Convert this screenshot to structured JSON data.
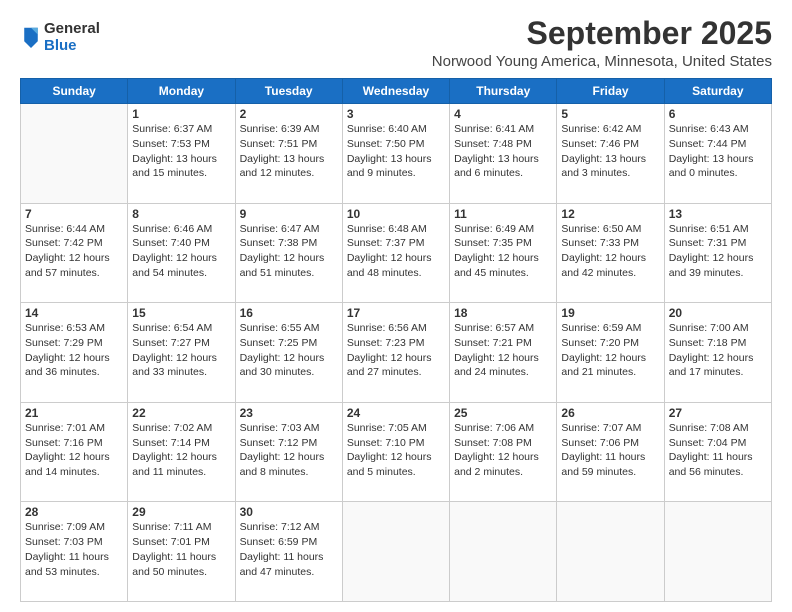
{
  "header": {
    "logo_line1": "General",
    "logo_line2": "Blue",
    "title": "September 2025",
    "subtitle": "Norwood Young America, Minnesota, United States"
  },
  "days_of_week": [
    "Sunday",
    "Monday",
    "Tuesday",
    "Wednesday",
    "Thursday",
    "Friday",
    "Saturday"
  ],
  "weeks": [
    [
      {
        "day": "",
        "info": ""
      },
      {
        "day": "1",
        "info": "Sunrise: 6:37 AM\nSunset: 7:53 PM\nDaylight: 13 hours\nand 15 minutes."
      },
      {
        "day": "2",
        "info": "Sunrise: 6:39 AM\nSunset: 7:51 PM\nDaylight: 13 hours\nand 12 minutes."
      },
      {
        "day": "3",
        "info": "Sunrise: 6:40 AM\nSunset: 7:50 PM\nDaylight: 13 hours\nand 9 minutes."
      },
      {
        "day": "4",
        "info": "Sunrise: 6:41 AM\nSunset: 7:48 PM\nDaylight: 13 hours\nand 6 minutes."
      },
      {
        "day": "5",
        "info": "Sunrise: 6:42 AM\nSunset: 7:46 PM\nDaylight: 13 hours\nand 3 minutes."
      },
      {
        "day": "6",
        "info": "Sunrise: 6:43 AM\nSunset: 7:44 PM\nDaylight: 13 hours\nand 0 minutes."
      }
    ],
    [
      {
        "day": "7",
        "info": "Sunrise: 6:44 AM\nSunset: 7:42 PM\nDaylight: 12 hours\nand 57 minutes."
      },
      {
        "day": "8",
        "info": "Sunrise: 6:46 AM\nSunset: 7:40 PM\nDaylight: 12 hours\nand 54 minutes."
      },
      {
        "day": "9",
        "info": "Sunrise: 6:47 AM\nSunset: 7:38 PM\nDaylight: 12 hours\nand 51 minutes."
      },
      {
        "day": "10",
        "info": "Sunrise: 6:48 AM\nSunset: 7:37 PM\nDaylight: 12 hours\nand 48 minutes."
      },
      {
        "day": "11",
        "info": "Sunrise: 6:49 AM\nSunset: 7:35 PM\nDaylight: 12 hours\nand 45 minutes."
      },
      {
        "day": "12",
        "info": "Sunrise: 6:50 AM\nSunset: 7:33 PM\nDaylight: 12 hours\nand 42 minutes."
      },
      {
        "day": "13",
        "info": "Sunrise: 6:51 AM\nSunset: 7:31 PM\nDaylight: 12 hours\nand 39 minutes."
      }
    ],
    [
      {
        "day": "14",
        "info": "Sunrise: 6:53 AM\nSunset: 7:29 PM\nDaylight: 12 hours\nand 36 minutes."
      },
      {
        "day": "15",
        "info": "Sunrise: 6:54 AM\nSunset: 7:27 PM\nDaylight: 12 hours\nand 33 minutes."
      },
      {
        "day": "16",
        "info": "Sunrise: 6:55 AM\nSunset: 7:25 PM\nDaylight: 12 hours\nand 30 minutes."
      },
      {
        "day": "17",
        "info": "Sunrise: 6:56 AM\nSunset: 7:23 PM\nDaylight: 12 hours\nand 27 minutes."
      },
      {
        "day": "18",
        "info": "Sunrise: 6:57 AM\nSunset: 7:21 PM\nDaylight: 12 hours\nand 24 minutes."
      },
      {
        "day": "19",
        "info": "Sunrise: 6:59 AM\nSunset: 7:20 PM\nDaylight: 12 hours\nand 21 minutes."
      },
      {
        "day": "20",
        "info": "Sunrise: 7:00 AM\nSunset: 7:18 PM\nDaylight: 12 hours\nand 17 minutes."
      }
    ],
    [
      {
        "day": "21",
        "info": "Sunrise: 7:01 AM\nSunset: 7:16 PM\nDaylight: 12 hours\nand 14 minutes."
      },
      {
        "day": "22",
        "info": "Sunrise: 7:02 AM\nSunset: 7:14 PM\nDaylight: 12 hours\nand 11 minutes."
      },
      {
        "day": "23",
        "info": "Sunrise: 7:03 AM\nSunset: 7:12 PM\nDaylight: 12 hours\nand 8 minutes."
      },
      {
        "day": "24",
        "info": "Sunrise: 7:05 AM\nSunset: 7:10 PM\nDaylight: 12 hours\nand 5 minutes."
      },
      {
        "day": "25",
        "info": "Sunrise: 7:06 AM\nSunset: 7:08 PM\nDaylight: 12 hours\nand 2 minutes."
      },
      {
        "day": "26",
        "info": "Sunrise: 7:07 AM\nSunset: 7:06 PM\nDaylight: 11 hours\nand 59 minutes."
      },
      {
        "day": "27",
        "info": "Sunrise: 7:08 AM\nSunset: 7:04 PM\nDaylight: 11 hours\nand 56 minutes."
      }
    ],
    [
      {
        "day": "28",
        "info": "Sunrise: 7:09 AM\nSunset: 7:03 PM\nDaylight: 11 hours\nand 53 minutes."
      },
      {
        "day": "29",
        "info": "Sunrise: 7:11 AM\nSunset: 7:01 PM\nDaylight: 11 hours\nand 50 minutes."
      },
      {
        "day": "30",
        "info": "Sunrise: 7:12 AM\nSunset: 6:59 PM\nDaylight: 11 hours\nand 47 minutes."
      },
      {
        "day": "",
        "info": ""
      },
      {
        "day": "",
        "info": ""
      },
      {
        "day": "",
        "info": ""
      },
      {
        "day": "",
        "info": ""
      }
    ]
  ]
}
